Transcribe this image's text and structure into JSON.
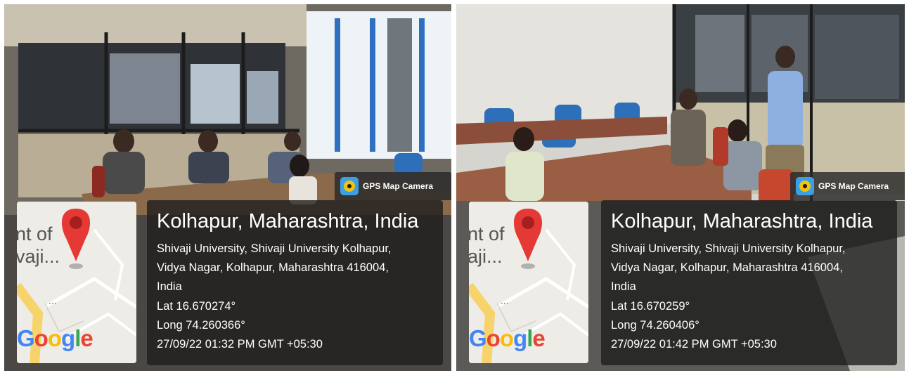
{
  "photos": [
    {
      "badge": "GPS Map Camera",
      "city": "Kolhapur, Maharashtra, India",
      "address_line1": "Shivaji University, Shivaji University Kolhapur,",
      "address_line2": "Vidya Nagar, Kolhapur, Maharashtra 416004,",
      "address_line3": "India",
      "lat": "Lat 16.670274°",
      "long": "Long 74.260366°",
      "timestamp": "27/09/22 01:32 PM GMT +05:30",
      "map_place_line1": "nt of",
      "map_place_line2": "vaji...",
      "map_more": "...",
      "google": [
        "G",
        "o",
        "o",
        "g",
        "l",
        "e"
      ]
    },
    {
      "badge": "GPS Map Camera",
      "city": "Kolhapur, Maharashtra, India",
      "address_line1": "Shivaji University, Shivaji University Kolhapur,",
      "address_line2": "Vidya Nagar, Kolhapur, Maharashtra 416004,",
      "address_line3": "India",
      "lat": "Lat 16.670259°",
      "long": "Long 74.260406°",
      "timestamp": "27/09/22 01:42 PM GMT +05:30",
      "map_place_line1": "nt of",
      "map_place_line2": "aji...",
      "map_more": "...",
      "google": [
        "G",
        "o",
        "o",
        "g",
        "l",
        "e"
      ]
    }
  ],
  "colors": {
    "google_blue": "#4285f4",
    "google_red": "#ea4335",
    "google_yellow": "#fbbc05",
    "google_green": "#34a853",
    "pin_red": "#e53935"
  }
}
